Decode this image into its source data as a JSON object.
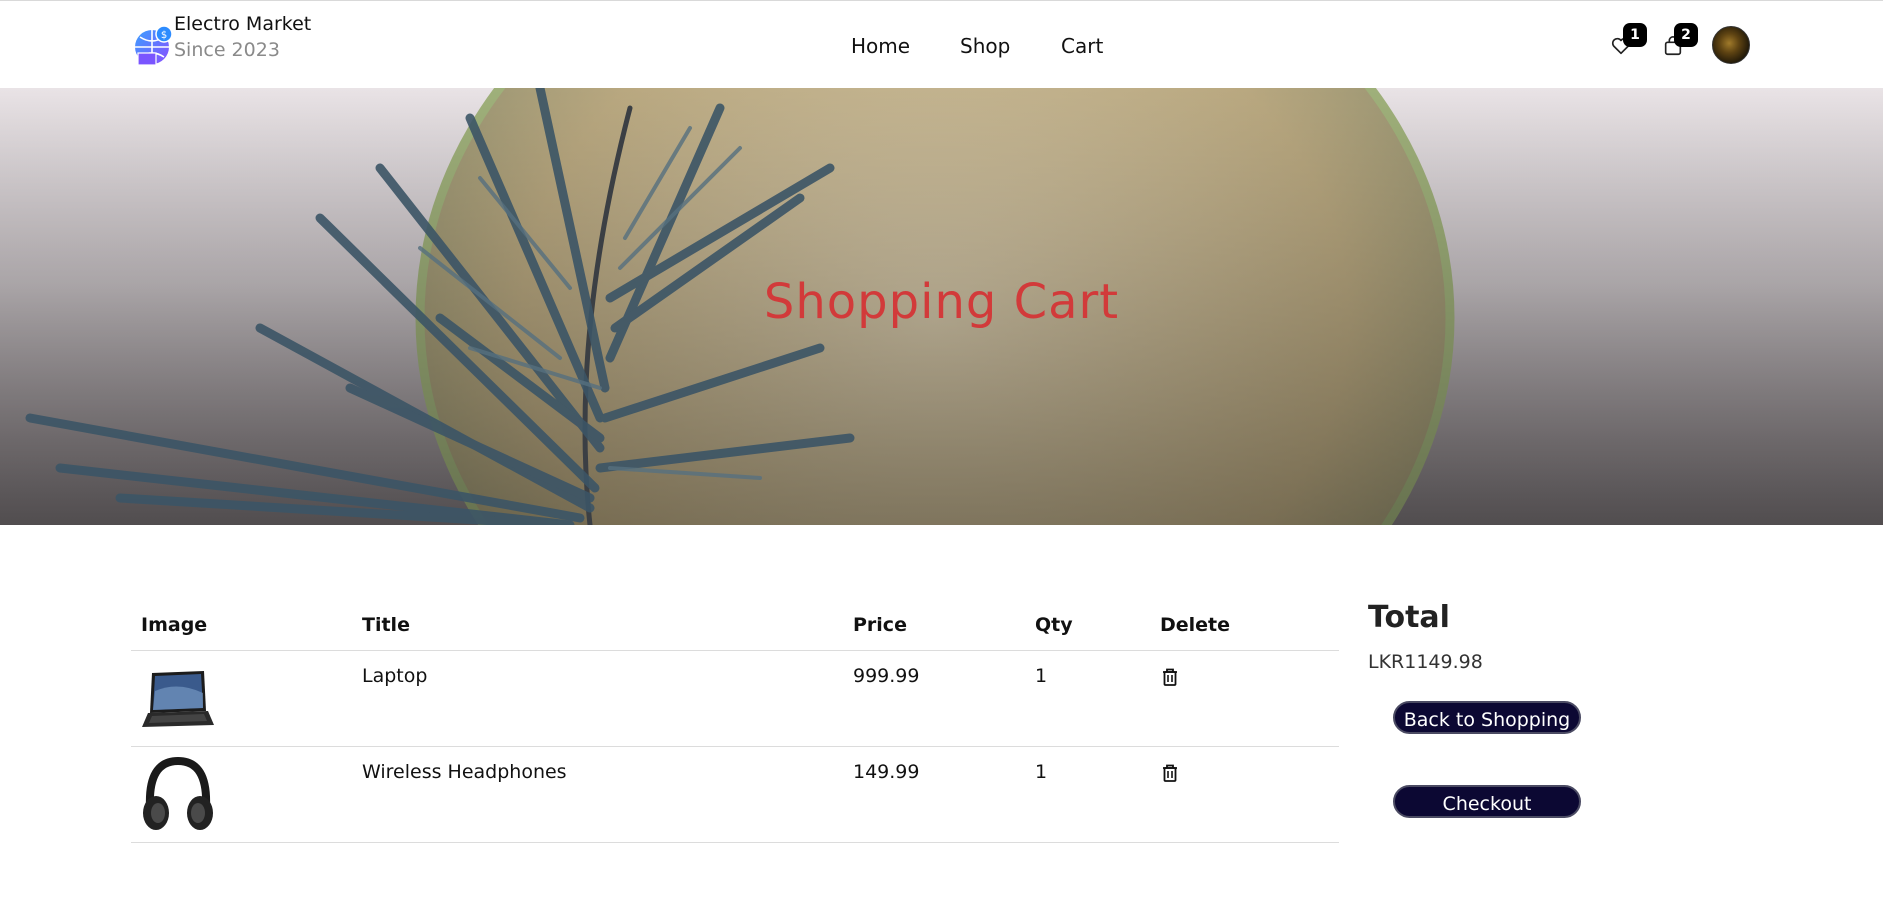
{
  "brand": {
    "name": "Electro Market",
    "since": "Since 2023"
  },
  "nav": {
    "items": [
      "Home",
      "Shop",
      "Cart"
    ]
  },
  "header_icons": {
    "wishlist_count": "1",
    "cart_count": "2"
  },
  "hero": {
    "title": "Shopping Cart"
  },
  "table": {
    "headers": [
      "Image",
      "Title",
      "Price",
      "Qty",
      "Delete"
    ],
    "rows": [
      {
        "image": "laptop-thumbnail",
        "title": "Laptop",
        "price": "999.99",
        "qty": "1"
      },
      {
        "image": "headphones-thumbnail",
        "title": "Wireless Headphones",
        "price": "149.99",
        "qty": "1"
      }
    ]
  },
  "summary": {
    "title": "Total",
    "value": "LKR1149.98",
    "back_label": "Back to Shopping",
    "checkout_label": "Checkout"
  },
  "colors": {
    "accent_title": "#d23a3a",
    "button_bg": "#0c0833"
  }
}
